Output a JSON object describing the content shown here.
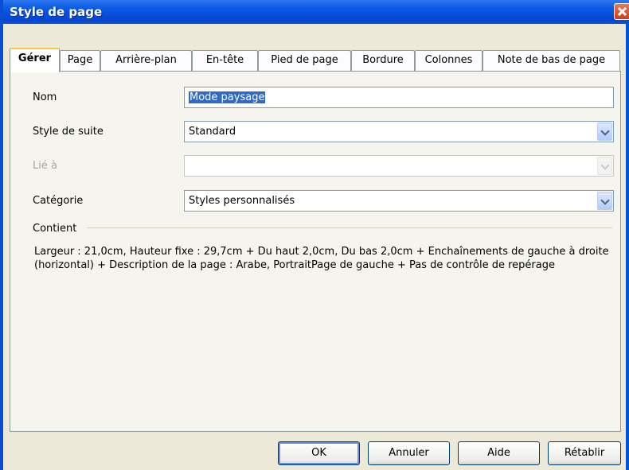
{
  "window": {
    "title": "Style de page"
  },
  "tabs": [
    {
      "label": "Gérer"
    },
    {
      "label": "Page"
    },
    {
      "label": "Arrière-plan"
    },
    {
      "label": "En-tête"
    },
    {
      "label": "Pied de page"
    },
    {
      "label": "Bordure"
    },
    {
      "label": "Colonnes"
    },
    {
      "label": "Note de bas de page"
    }
  ],
  "form": {
    "name_label": "Nom",
    "name_value": "Mode paysage",
    "next_style_label": "Style de suite",
    "next_style_value": "Standard",
    "linked_label": "Lié à",
    "linked_value": "",
    "category_label": "Catégorie",
    "category_value": "Styles personnalisés"
  },
  "contains": {
    "label": "Contient",
    "text": "Largeur : 21,0cm, Hauteur fixe : 29,7cm + Du haut 2,0cm, Du bas 2,0cm + Enchaînements de gauche à droite (horizontal) + Description de la page : Arabe, PortraitPage de gauche + Pas de contrôle de repérage"
  },
  "buttons": {
    "ok": "OK",
    "cancel": "Annuler",
    "help": "Aide",
    "reset": "Rétablir"
  }
}
